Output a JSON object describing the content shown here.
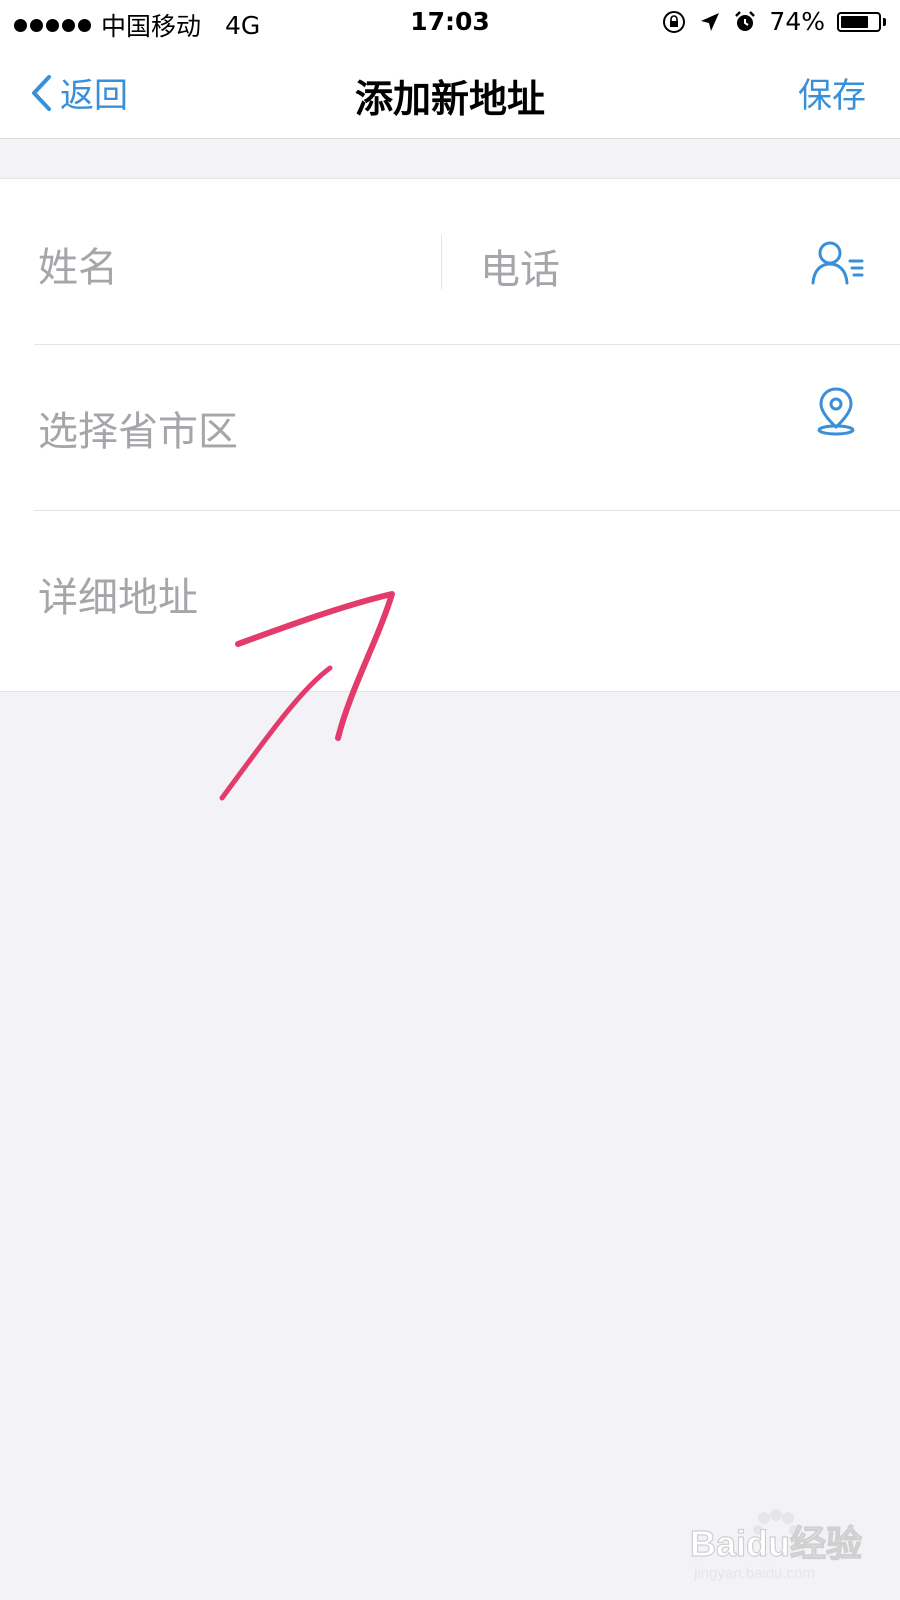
{
  "status": {
    "carrier": "中国移动",
    "network": "4G",
    "time": "17:03",
    "battery": "74%",
    "battery_level": 0.74
  },
  "nav": {
    "back_label": "返回",
    "title": "添加新地址",
    "save_label": "保存"
  },
  "form": {
    "name_placeholder": "姓名",
    "phone_placeholder": "电话",
    "region_placeholder": "选择省市区",
    "address_placeholder": "详细地址"
  },
  "icons": {
    "contacts": "contacts-icon",
    "location": "location-pin-icon",
    "back": "chevron-left-icon"
  },
  "colors": {
    "accent": "#3a8fd9",
    "placeholder": "#a5a5aa",
    "annotation": "#e33b6c",
    "background": "#f3f2f7"
  },
  "watermark": {
    "brand": "Baidu经验",
    "url": "jingyan.baidu.com"
  }
}
